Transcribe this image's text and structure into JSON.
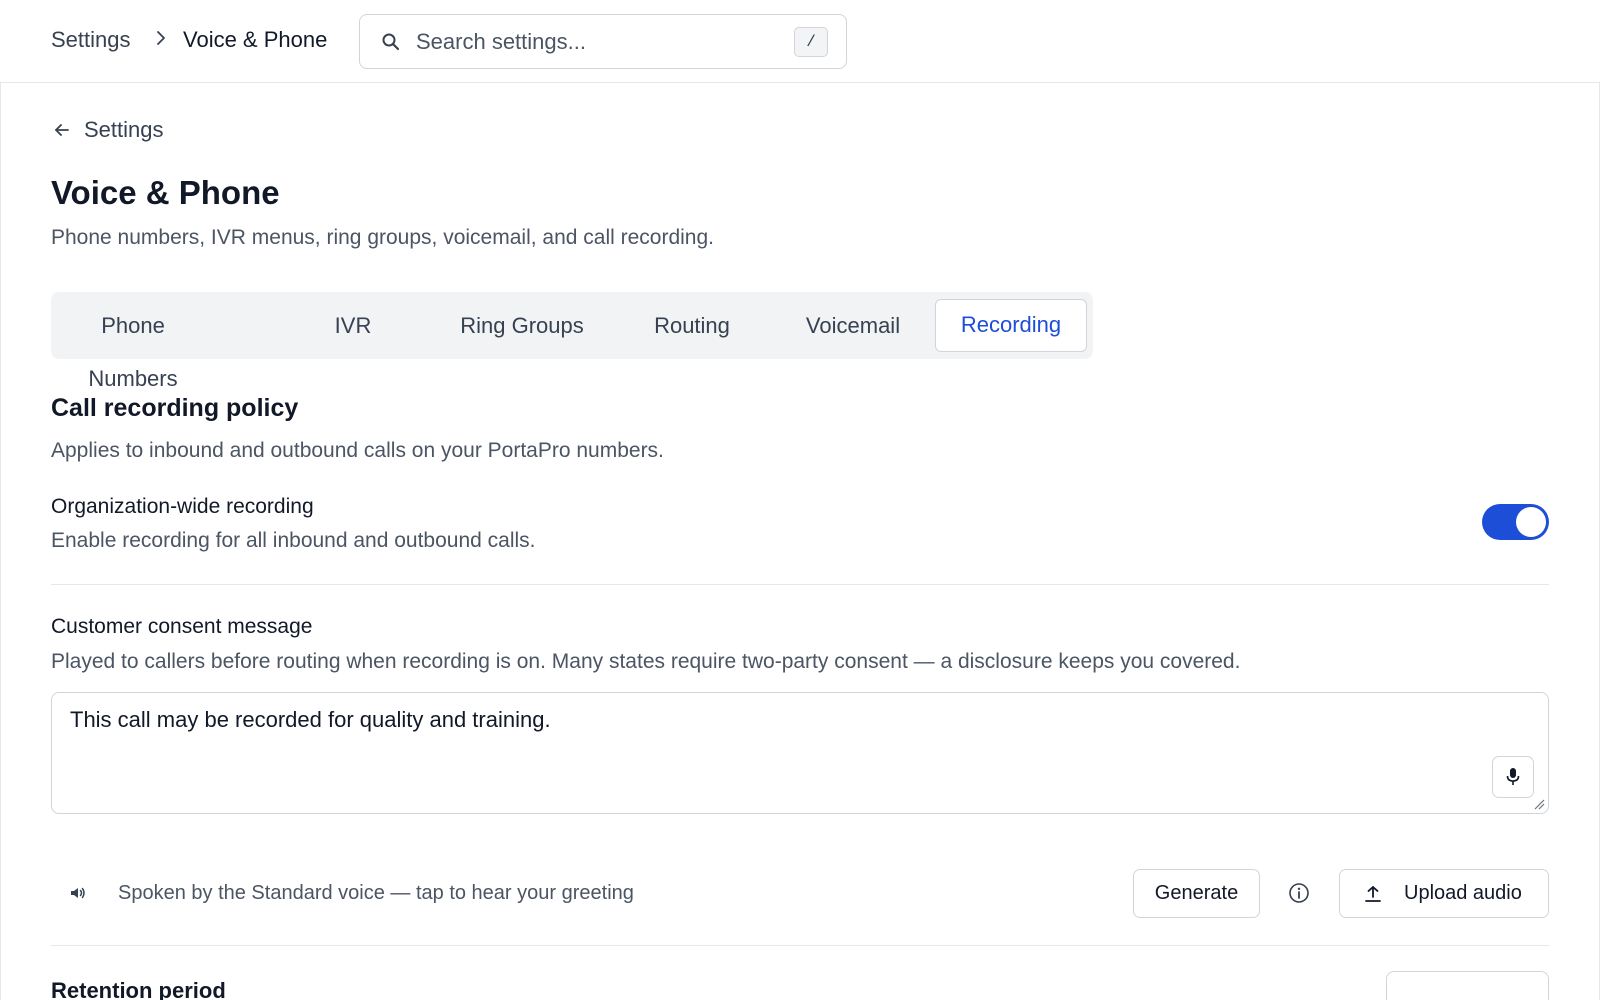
{
  "breadcrumb": {
    "root": "Settings",
    "current": "Voice & Phone"
  },
  "search": {
    "placeholder": "Search settings...",
    "shortcut": "/"
  },
  "back": {
    "label": "Settings"
  },
  "page": {
    "title": "Voice & Phone",
    "subtitle": "Phone numbers, IVR menus, ring groups, voicemail, and call recording."
  },
  "tabs": [
    {
      "label": "Phone Numbers",
      "active": false
    },
    {
      "label": "IVR",
      "active": false
    },
    {
      "label": "Ring Groups",
      "active": false
    },
    {
      "label": "Routing",
      "active": false
    },
    {
      "label": "Voicemail",
      "active": false
    },
    {
      "label": "Recording",
      "active": true
    }
  ],
  "policy": {
    "title": "Call recording policy",
    "description": "Applies to inbound and outbound calls on your PortaPro numbers."
  },
  "org_recording": {
    "label": "Organization-wide recording",
    "description": "Enable recording for all inbound and outbound calls.",
    "enabled": true
  },
  "consent": {
    "label": "Customer consent message",
    "description": "Played to callers before routing when recording is on. Many states require two-party consent — a disclosure keeps you covered.",
    "value": "This call may be recorded for quality and training.",
    "voice_hint": "Spoken by the Standard voice — tap to hear your greeting",
    "generate_label": "Generate",
    "upload_label": "Upload audio"
  },
  "retention": {
    "label": "Retention period"
  },
  "colors": {
    "accent": "#1d4ed8",
    "border": "#d1d5db",
    "muted_text": "#4b5563",
    "tab_bar_bg": "#f1f3f5"
  },
  "icons": [
    "chevron-right-icon",
    "search-icon",
    "arrow-left-icon",
    "microphone-icon",
    "speaker-icon",
    "info-icon",
    "upload-icon"
  ]
}
